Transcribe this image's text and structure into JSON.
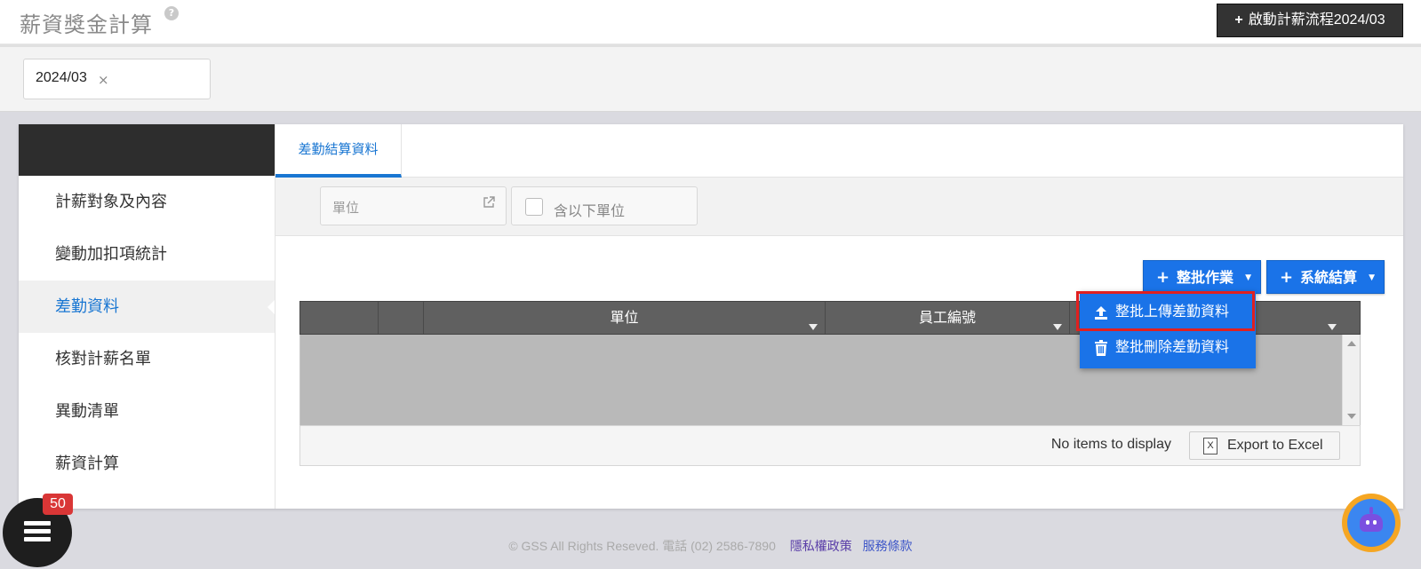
{
  "header": {
    "title": "薪資獎金計算",
    "help": "?",
    "start_button_plus": "+",
    "start_button": "啟動計薪流程2024/03"
  },
  "period": {
    "value": "2024/03",
    "remove": "×"
  },
  "sidebar": {
    "items": [
      {
        "label": "計薪對象及內容"
      },
      {
        "label": "變動加扣項統計"
      },
      {
        "label": "差勤資料"
      },
      {
        "label": "核對計薪名單"
      },
      {
        "label": "異動清單"
      },
      {
        "label": "薪資計算"
      }
    ],
    "active_index": 2
  },
  "tabs": [
    {
      "label": "差勤結算資料"
    }
  ],
  "filters": {
    "unit_placeholder": "單位",
    "include_sub_units": "含以下單位"
  },
  "toolbar": {
    "plus": "+",
    "batch_button": "整批作業",
    "system_button": "系統結算",
    "caret": "▼"
  },
  "dropdown": {
    "items": [
      {
        "label": "整批上傳差勤資料",
        "icon": "upload-icon"
      },
      {
        "label": "整批刪除差勤資料",
        "icon": "trash-icon"
      }
    ]
  },
  "grid": {
    "columns": [
      "",
      "",
      "單位",
      "員工編號",
      ""
    ],
    "rows": [],
    "empty_text": "No items to display",
    "export_label": "Export to Excel",
    "export_icon_text": "X"
  },
  "footer": {
    "copyright": "© GSS All Rights Reseved. 電話 (02) 2586-7890",
    "privacy": "隱私權政策",
    "terms": "服務條款"
  },
  "notifications": {
    "count": "50"
  },
  "colors": {
    "accent": "#1a73e8",
    "highlight": "#e02020",
    "dark": "#333333"
  }
}
